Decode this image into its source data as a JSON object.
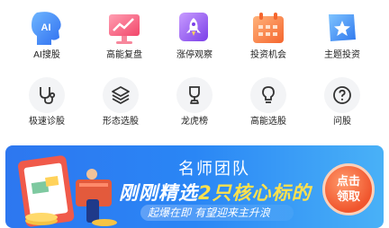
{
  "top_row": [
    {
      "label": "AI搜股",
      "icon": "ai-head-icon",
      "icon_text": "AI"
    },
    {
      "label": "高能复盘",
      "icon": "chart-board-icon"
    },
    {
      "label": "涨停观察",
      "icon": "rocket-icon"
    },
    {
      "label": "投资机会",
      "icon": "calendar-icon"
    },
    {
      "label": "主题投资",
      "icon": "star-book-icon"
    }
  ],
  "mid_row": [
    {
      "label": "极速诊股",
      "icon": "stethoscope-icon"
    },
    {
      "label": "形态选股",
      "icon": "layers-icon"
    },
    {
      "label": "龙虎榜",
      "icon": "trophy-icon"
    },
    {
      "label": "高能选股",
      "icon": "lightbulb-icon"
    },
    {
      "label": "问股",
      "icon": "question-icon"
    }
  ],
  "banner": {
    "title": "名师团队",
    "headline_prefix": "刚刚精选",
    "headline_highlight": "2只核心标的",
    "subtitle": "起爆在即 有望迎来主升浪",
    "button_line1": "点击",
    "button_line2": "领取"
  },
  "colors": {
    "banner_blue": "#2d77f0",
    "accent_yellow": "#ffe14d",
    "button_orange": "#f0552d"
  }
}
